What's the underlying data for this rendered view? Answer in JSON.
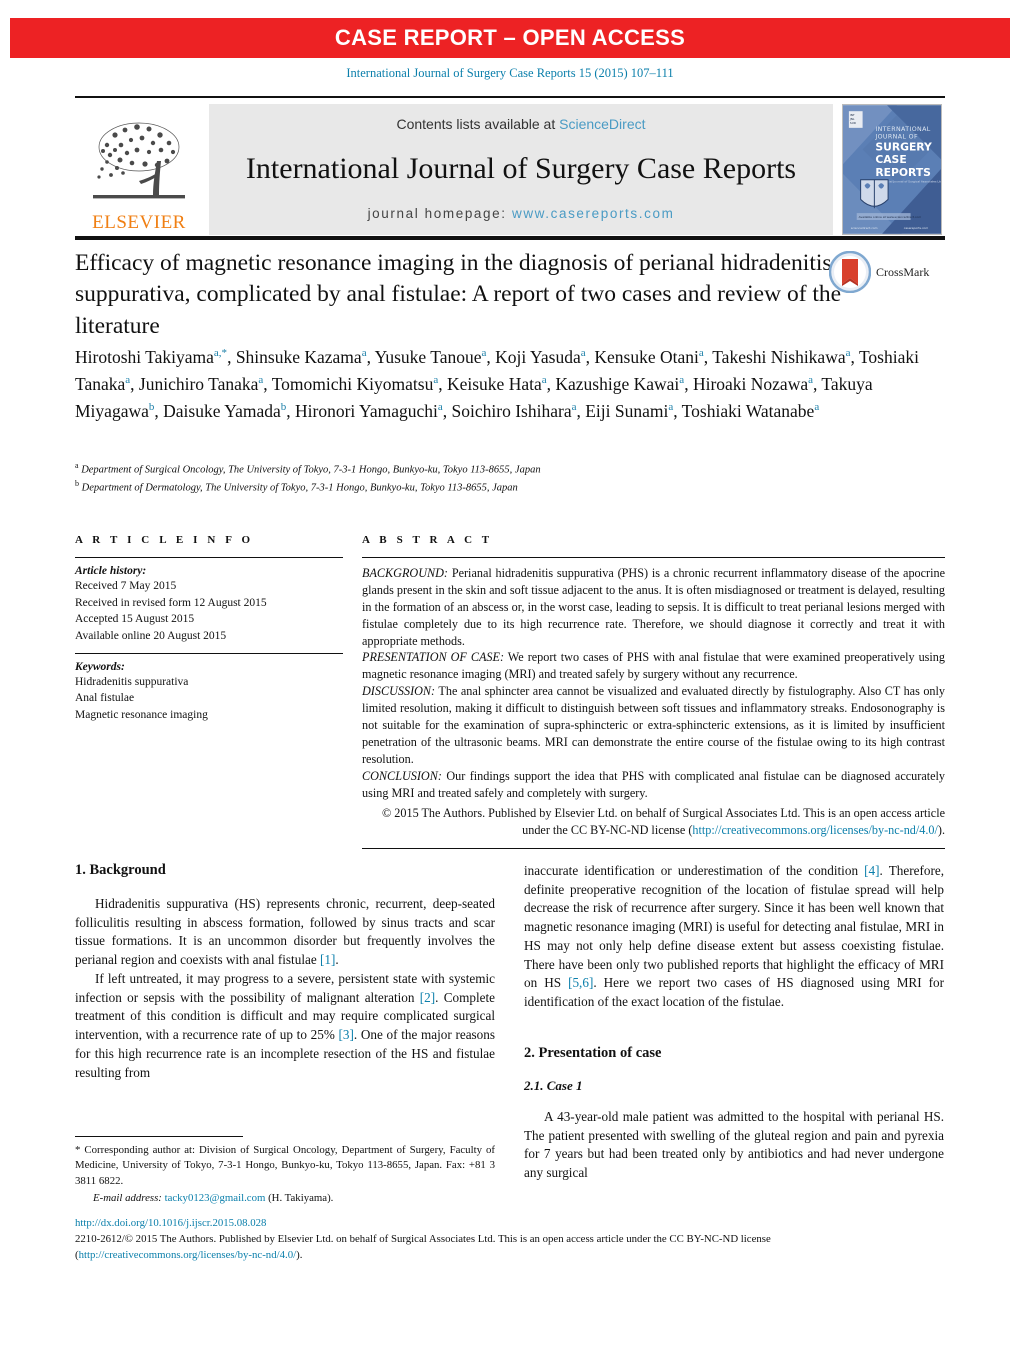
{
  "banner": {
    "text": "CASE REPORT – OPEN ACCESS",
    "color": "#ED2224"
  },
  "citation": "International Journal of Surgery Case Reports 15 (2015) 107–111",
  "masthead": {
    "publisher": "ELSEVIER",
    "contents_prefix": "Contents lists available at ",
    "contents_link": "ScienceDirect",
    "journal_title": "International Journal of Surgery Case Reports",
    "homepage_label": "journal homepage: ",
    "homepage_url": "www.casereports.com",
    "cover_lines": [
      "INTERNATIONAL",
      "JOURNAL OF",
      "SURGERY",
      "CASE",
      "REPORTS"
    ],
    "link_color": "#4A9BC4"
  },
  "article": {
    "title": "Efficacy of magnetic resonance imaging in the diagnosis of perianal hidradenitis suppurativa, complicated by anal fistulae: A report of two cases and review of the literature",
    "crossmark_label": "CrossMark",
    "authors_html": "Hirotoshi Takiyama<sup>a,*</sup>, Shinsuke Kazama<sup>a</sup>, Yusuke Tanoue<sup>a</sup>, Koji Yasuda<sup>a</sup>, Kensuke Otani<sup>a</sup>, Takeshi Nishikawa<sup>a</sup>, Toshiaki Tanaka<sup>a</sup>, Junichiro Tanaka<sup>a</sup>, Tomomichi Kiyomatsu<sup>a</sup>, Keisuke Hata<sup>a</sup>, Kazushige Kawai<sup>a</sup>, Hiroaki Nozawa<sup>a</sup>, Takuya Miyagawa<sup>b</sup>, Daisuke Yamada<sup>b</sup>, Hironori Yamaguchi<sup>a</sup>, Soichiro Ishihara<sup>a</sup>, Eiji Sunami<sup>a</sup>, Toshiaki Watanabe<sup>a</sup>",
    "affiliations_html": "<sup>a</sup> Department of Surgical Oncology, The University of Tokyo, 7-3-1 Hongo, Bunkyo-ku, Tokyo 113-8655, Japan<br><sup>b</sup> Department of Dermatology, The University of Tokyo, 7-3-1 Hongo, Bunkyo-ku, Tokyo 113-8655, Japan"
  },
  "article_info": {
    "heading": "A R T I C L E   I N F O",
    "history_label": "Article history:",
    "history": [
      "Received 7 May 2015",
      "Received in revised form 12 August 2015",
      "Accepted 15 August 2015",
      "Available online 20 August 2015"
    ],
    "keywords_label": "Keywords:",
    "keywords": [
      "Hidradenitis suppurativa",
      "Anal fistulae",
      "Magnetic resonance imaging"
    ]
  },
  "abstract": {
    "heading": "A B S T R A C T",
    "background_tag": "BACKGROUND:",
    "background": " Perianal hidradenitis suppurativa (PHS) is a chronic recurrent inflammatory disease of the apocrine glands present in the skin and soft tissue adjacent to the anus. It is often misdiagnosed or treatment is delayed, resulting in the formation of an abscess or, in the worst case, leading to sepsis. It is difficult to treat perianal lesions merged with fistulae completely due to its high recurrence rate. Therefore, we should diagnose it correctly and treat it with appropriate methods.",
    "presentation_tag": "PRESENTATION OF CASE:",
    "presentation": " We report two cases of PHS with anal fistulae that were examined preoperatively using magnetic resonance imaging (MRI) and treated safely by surgery without any recurrence.",
    "discussion_tag": "DISCUSSION:",
    "discussion": " The anal sphincter area cannot be visualized and evaluated directly by fistulography. Also CT has only limited resolution, making it difficult to distinguish between soft tissues and inflammatory streaks. Endosonography is not suitable for the examination of supra-sphincteric or extra-sphincteric extensions, as it is limited by insufficient penetration of the ultrasonic beams. MRI can demonstrate the entire course of the fistulae owing to its high contrast resolution.",
    "conclusion_tag": "CONCLUSION:",
    "conclusion": " Our findings support the idea that PHS with complicated anal fistulae can be diagnosed accurately using MRI and treated safely and completely with surgery.",
    "copyright_text": "© 2015 The Authors. Published by Elsevier Ltd. on behalf of Surgical Associates Ltd. This is an open access article under the CC BY-NC-ND license (",
    "copyright_link": "http://creativecommons.org/licenses/by-nc-nd/4.0/",
    "copyright_tail": ")."
  },
  "body": {
    "left": {
      "section1_heading": "1.  Background",
      "p1_a": "Hidradenitis suppurativa (HS) represents chronic, recurrent, deep-seated folliculitis resulting in abscess formation, followed by sinus tracts and scar tissue formations. It is an uncommon disorder but frequently involves the perianal region and coexists with anal fistulae ",
      "p1_ref": "[1]",
      "p1_b": ".",
      "p2_a": "If left untreated, it may progress to a severe, persistent state with systemic infection or sepsis with the possibility of malignant alteration ",
      "p2_ref1": "[2]",
      "p2_b": ". Complete treatment of this condition is difficult and may require complicated surgical intervention, with a recurrence rate of up to 25% ",
      "p2_ref2": "[3]",
      "p2_c": ". One of the major reasons for this high recurrence rate is an incomplete resection of the HS and fistulae resulting from"
    },
    "right": {
      "p3_a": "inaccurate identification or underestimation of the condition ",
      "p3_ref1": "[4]",
      "p3_b": ". Therefore, definite preoperative recognition of the location of fistulae spread will help decrease the risk of recurrence after surgery. Since it has been well known that magnetic resonance imaging (MRI) is useful for detecting anal fistulae, MRI in HS may not only help define disease extent but assess coexisting fistulae. There have been only two published reports that highlight the efficacy of MRI on HS ",
      "p3_ref2": "[5,6]",
      "p3_c": ". Here we report two cases of HS diagnosed using MRI for identification of the exact location of the fistulae.",
      "section2_heading": "2.  Presentation of case",
      "subsection_heading": "2.1.  Case 1",
      "p4": "A 43-year-old male patient was admitted to the hospital with perianal HS. The patient presented with swelling of the gluteal region and pain and pyrexia for 7 years but had been treated only by antibiotics and had never undergone any surgical"
    }
  },
  "footnote": {
    "star": "*",
    "corresponding": " Corresponding author at: Division of Surgical Oncology, Department of Surgery, Faculty of Medicine, University of Tokyo, 7-3-1 Hongo, Bunkyo-ku, Tokyo 113-8655, Japan. Fax: +81 3 3811 6822.",
    "email_label": "E-mail address:",
    "email": "tacky0123@gmail.com",
    "email_owner": " (H. Takiyama)."
  },
  "legal": {
    "doi": "http://dx.doi.org/10.1016/j.ijscr.2015.08.028",
    "line1": "2210-2612/© 2015 The Authors. Published by Elsevier Ltd. on behalf of Surgical Associates Ltd. This is an open access article under the CC BY-NC-ND license",
    "line2_open": "(",
    "line2_link": "http://creativecommons.org/licenses/by-nc-nd/4.0/",
    "line2_close": ")."
  }
}
